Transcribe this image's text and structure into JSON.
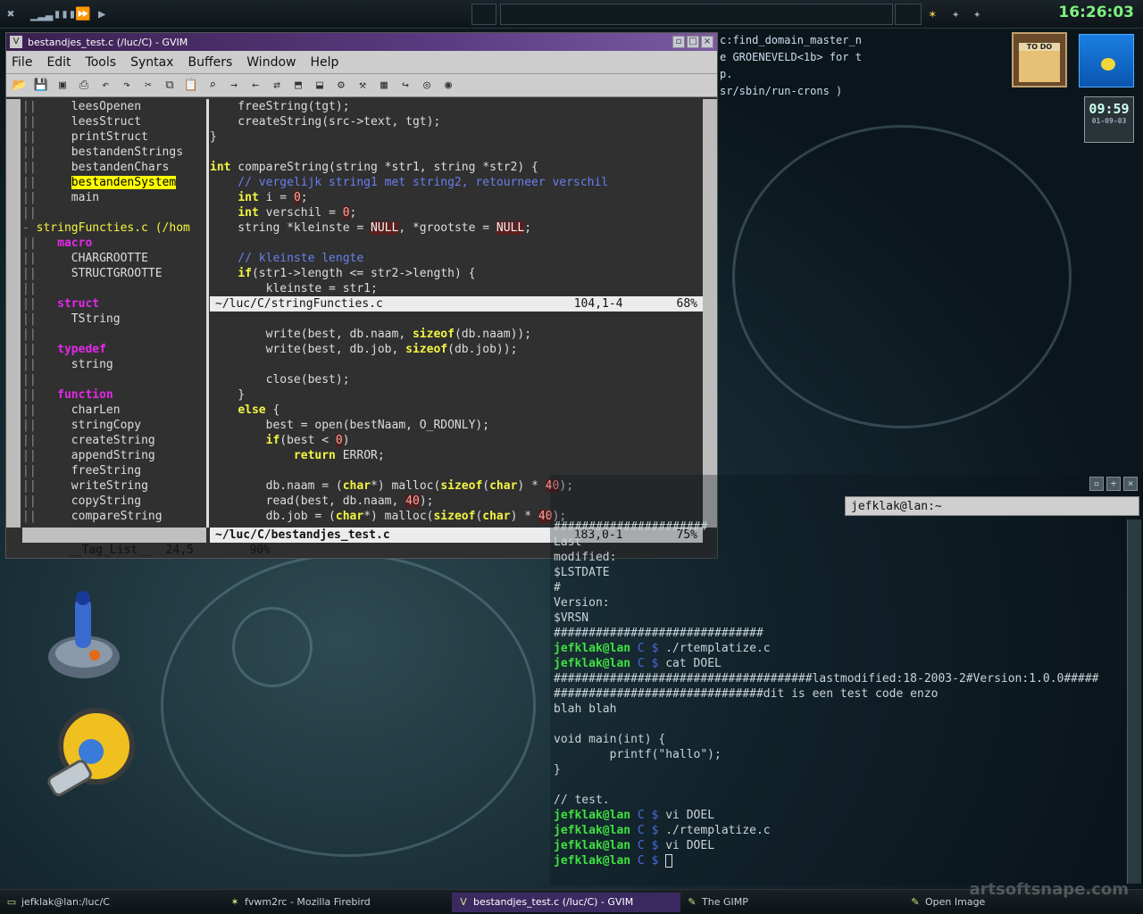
{
  "topbar": {
    "clock": "16:26:03"
  },
  "widgets": {
    "todo_label": "TO DO",
    "led_time": "09:59",
    "led_date": "01-09-03"
  },
  "background_terminal": {
    "lines": [
      "c:find_domain_master_n",
      "",
      "e GROENEVELD<1b> for t",
      "p.",
      "sr/sbin/run-crons )"
    ]
  },
  "gvim": {
    "title": "bestandjes_test.c (/luc/C) - GVIM",
    "menu": [
      "File",
      "Edit",
      "Tools",
      "Syntax",
      "Buffers",
      "Window",
      "Help"
    ],
    "taglist": [
      {
        "text": "leesOpenen",
        "indent": 3,
        "type": "item"
      },
      {
        "text": "leesStruct",
        "indent": 3,
        "type": "item"
      },
      {
        "text": "printStruct",
        "indent": 3,
        "type": "item"
      },
      {
        "text": "bestandenStrings",
        "indent": 3,
        "type": "item"
      },
      {
        "text": "bestandenChars",
        "indent": 3,
        "type": "item"
      },
      {
        "text": "bestandenSystem",
        "indent": 3,
        "type": "hl"
      },
      {
        "text": "main",
        "indent": 3,
        "type": "item"
      },
      {
        "text": "",
        "indent": 0,
        "type": "item"
      },
      {
        "text": "stringFuncties.c (/hom",
        "indent": 1,
        "type": "file"
      },
      {
        "text": "macro",
        "indent": 2,
        "type": "tag"
      },
      {
        "text": "CHARGROOTTE",
        "indent": 3,
        "type": "item"
      },
      {
        "text": "STRUCTGROOTTE",
        "indent": 3,
        "type": "item"
      },
      {
        "text": "",
        "indent": 0,
        "type": "item"
      },
      {
        "text": "struct",
        "indent": 2,
        "type": "tag"
      },
      {
        "text": "TString",
        "indent": 3,
        "type": "item"
      },
      {
        "text": "",
        "indent": 0,
        "type": "item"
      },
      {
        "text": "typedef",
        "indent": 2,
        "type": "tag"
      },
      {
        "text": "string",
        "indent": 3,
        "type": "item"
      },
      {
        "text": "",
        "indent": 0,
        "type": "item"
      },
      {
        "text": "function",
        "indent": 2,
        "type": "tag"
      },
      {
        "text": "charLen",
        "indent": 3,
        "type": "item"
      },
      {
        "text": "stringCopy",
        "indent": 3,
        "type": "item"
      },
      {
        "text": "createString",
        "indent": 3,
        "type": "item"
      },
      {
        "text": "appendString",
        "indent": 3,
        "type": "item"
      },
      {
        "text": "freeString",
        "indent": 3,
        "type": "item"
      },
      {
        "text": "writeString",
        "indent": 3,
        "type": "item"
      },
      {
        "text": "copyString",
        "indent": 3,
        "type": "item"
      },
      {
        "text": "compareString",
        "indent": 3,
        "type": "item"
      }
    ],
    "code_top": [
      "    freeString(tgt);",
      "    createString(src->text, tgt);",
      "}",
      "",
      "int compareString(string *str1, string *str2) {",
      "    // vergelijk string1 met string2, retourneer verschil",
      "    int i = 0;",
      "    int verschil = 0;",
      "    string *kleinste = NULL, *grootste = NULL;",
      "",
      "    // kleinste lengte",
      "    if(str1->length <= str2->length) {",
      "        kleinste = str1;"
    ],
    "status_top": {
      "file": "~/luc/C/stringFuncties.c",
      "pos": "104,1-4",
      "pct": "68%"
    },
    "code_bottom": [
      "",
      "        write(best, db.naam, sizeof(db.naam));",
      "        write(best, db.job, sizeof(db.job));",
      "",
      "        close(best);",
      "    }",
      "    else {",
      "        best = open(bestNaam, O_RDONLY);",
      "        if(best < 0)",
      "            return ERROR;",
      "",
      "        db.naam = (char*) malloc(sizeof(char) * 40);",
      "        read(best, db.naam, 40);",
      "        db.job = (char*) malloc(sizeof(char) * 40);"
    ],
    "status_bottom": {
      "file": "~/luc/C/bestandjes_test.c",
      "pos": "183,0-1",
      "pct": "75%"
    },
    "status_taglist": {
      "name": "__Tag_List__",
      "pos": "24,5",
      "pct": "90%"
    }
  },
  "terminal": {
    "tab": "jefklak@lan:~",
    "lines": [
      {
        "t": "plain",
        "v": "######################"
      },
      {
        "t": "plain",
        "v": "Last"
      },
      {
        "t": "plain",
        "v": "modified:"
      },
      {
        "t": "plain",
        "v": "$LSTDATE"
      },
      {
        "t": "plain",
        "v": "#"
      },
      {
        "t": "plain",
        "v": "Version:"
      },
      {
        "t": "plain",
        "v": "$VRSN"
      },
      {
        "t": "plain",
        "v": "##############################"
      },
      {
        "t": "prompt",
        "u": "jefklak@lan",
        "d": "C",
        "c": "./rtemplatize.c"
      },
      {
        "t": "prompt",
        "u": "jefklak@lan",
        "d": "C",
        "c": "cat DOEL"
      },
      {
        "t": "plain",
        "v": "#####################################lastmodified:18-2003-2#Version:1.0.0#####"
      },
      {
        "t": "plain",
        "v": "##############################dit is een test code enzo"
      },
      {
        "t": "plain",
        "v": "blah blah"
      },
      {
        "t": "plain",
        "v": ""
      },
      {
        "t": "plain",
        "v": "void main(int) {"
      },
      {
        "t": "plain",
        "v": "        printf(\"hallo\");"
      },
      {
        "t": "plain",
        "v": "}"
      },
      {
        "t": "plain",
        "v": ""
      },
      {
        "t": "plain",
        "v": "// test."
      },
      {
        "t": "prompt",
        "u": "jefklak@lan",
        "d": "C",
        "c": "vi DOEL"
      },
      {
        "t": "prompt",
        "u": "jefklak@lan",
        "d": "C",
        "c": "./rtemplatize.c"
      },
      {
        "t": "prompt",
        "u": "jefklak@lan",
        "d": "C",
        "c": "vi DOEL"
      },
      {
        "t": "prompt",
        "u": "jefklak@lan",
        "d": "C",
        "c": "",
        "cursor": true
      }
    ]
  },
  "taskbar": [
    {
      "label": "jefklak@lan:/luc/C",
      "icon": "terminal-icon",
      "active": false
    },
    {
      "label": "fvwm2rc - Mozilla Firebird",
      "icon": "firebird-icon",
      "active": false
    },
    {
      "label": "bestandjes_test.c (/luc/C) - GVIM",
      "icon": "gvim-icon",
      "active": true
    },
    {
      "label": "The GIMP",
      "icon": "gimp-icon",
      "active": false
    },
    {
      "label": "Open Image",
      "icon": "gimp-icon",
      "active": false
    }
  ],
  "watermark": "artsoftsnape.com"
}
